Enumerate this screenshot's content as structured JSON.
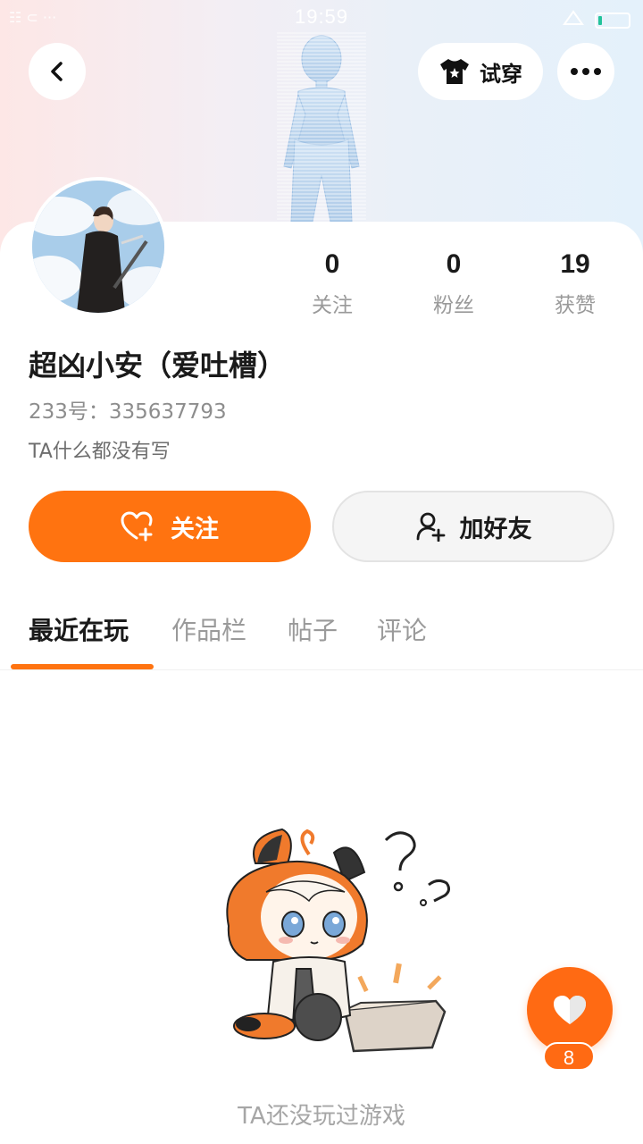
{
  "status_bar": {
    "time": "19:59",
    "left_text": "☷ ⊂ ···"
  },
  "header": {
    "try_on_label": "试穿"
  },
  "profile": {
    "stats": [
      {
        "value": "0",
        "label": "关注"
      },
      {
        "value": "0",
        "label": "粉丝"
      },
      {
        "value": "19",
        "label": "获赞"
      }
    ],
    "name": "超凶小安（爱吐槽）",
    "id_text": "233号：335637793",
    "bio": "TA什么都没有写"
  },
  "actions": {
    "follow_label": "关注",
    "add_friend_label": "加好友"
  },
  "tabs": [
    {
      "label": "最近在玩",
      "active": true
    },
    {
      "label": "作品栏",
      "active": false
    },
    {
      "label": "帖子",
      "active": false
    },
    {
      "label": "评论",
      "active": false
    }
  ],
  "empty_state": {
    "text": "TA还没玩过游戏"
  },
  "like_fab": {
    "count": "8"
  },
  "colors": {
    "accent": "#ff7310",
    "muted": "#9a9a9a"
  }
}
